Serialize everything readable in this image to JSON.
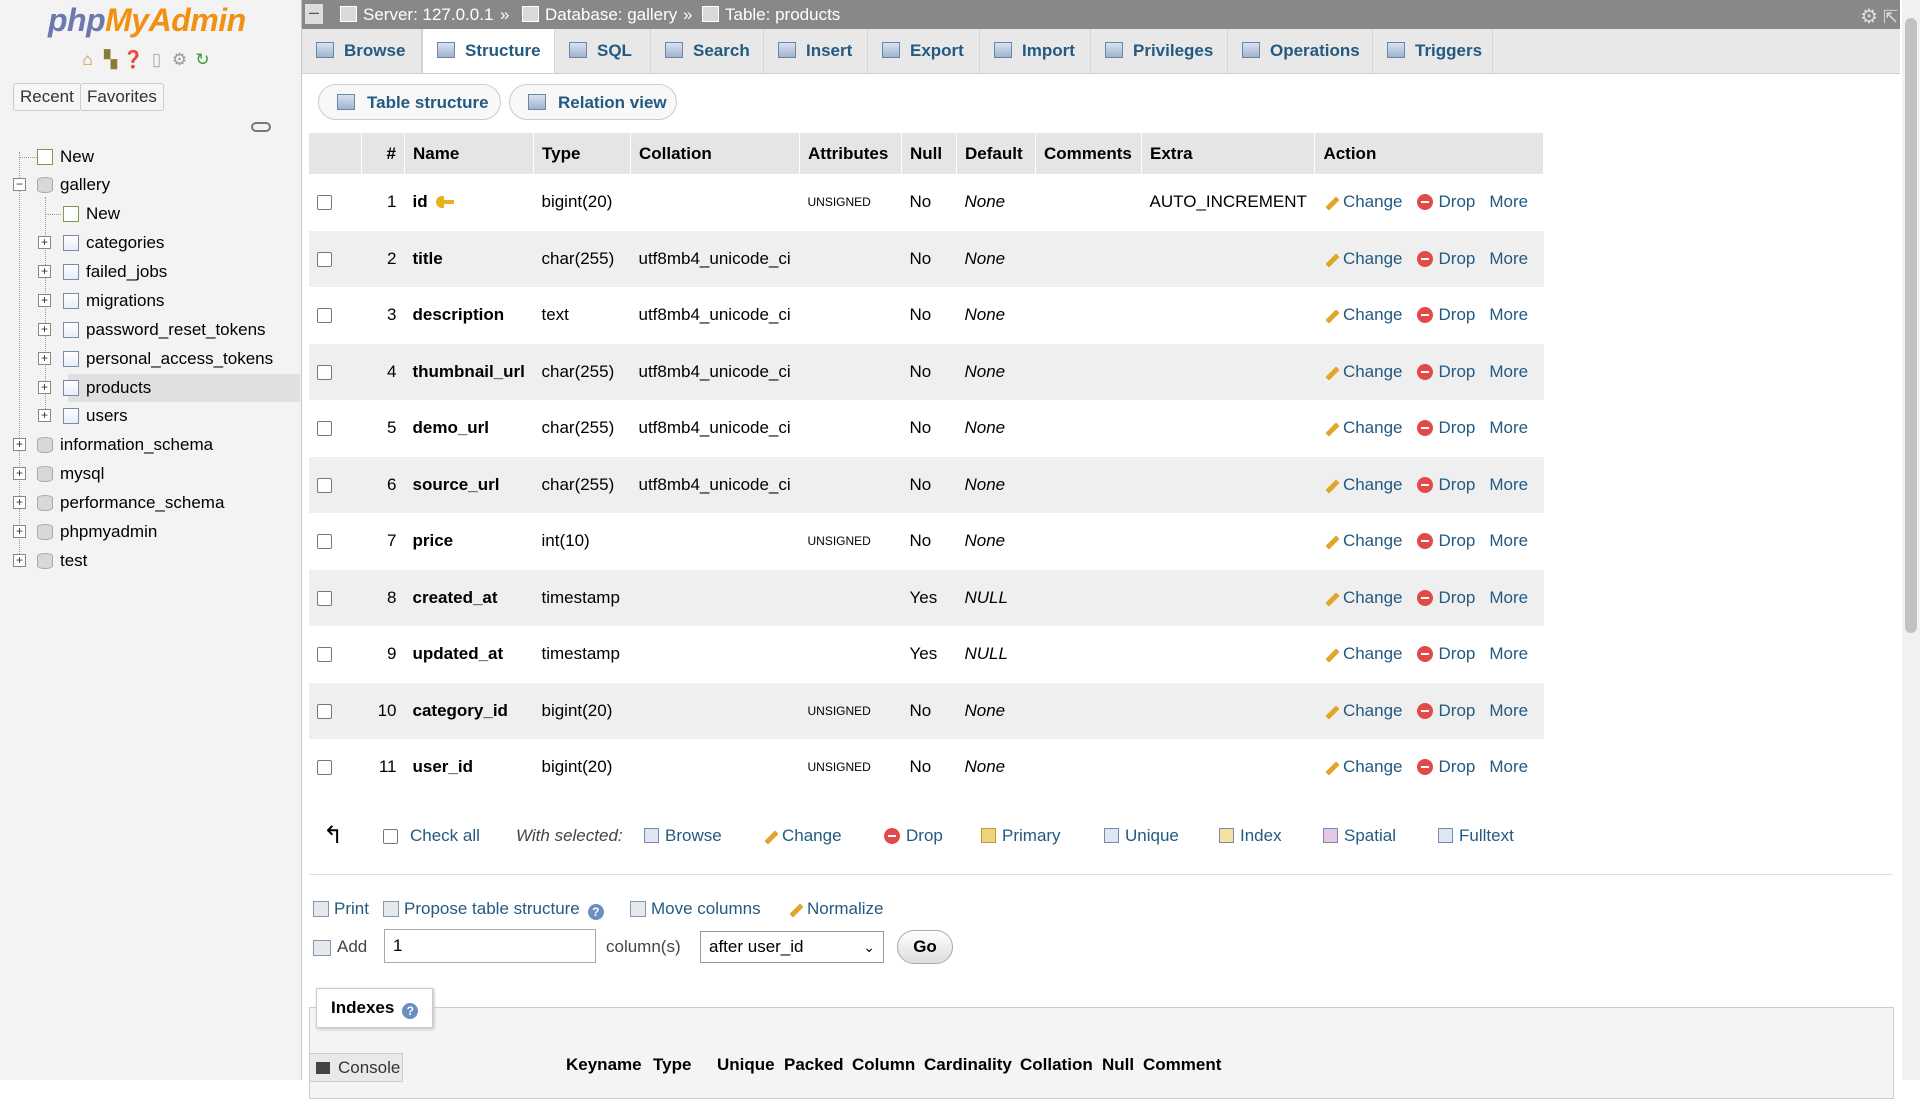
{
  "logo": {
    "php": "php",
    "myadmin": "MyAdmin"
  },
  "sidebar": {
    "quick_icons": [
      "home-icon",
      "exit-icon",
      "help-icon",
      "docs-icon",
      "settings-icon",
      "reload-icon"
    ],
    "recent_label": "Recent",
    "favorites_label": "Favorites",
    "tree": {
      "new_label": "New",
      "gallery": {
        "label": "gallery",
        "new_label": "New",
        "tables": [
          "categories",
          "failed_jobs",
          "migrations",
          "password_reset_tokens",
          "personal_access_tokens",
          "products",
          "users"
        ]
      },
      "databases": [
        "information_schema",
        "mysql",
        "performance_schema",
        "phpmyadmin",
        "test"
      ]
    }
  },
  "topbar": {
    "server": "Server: 127.0.0.1",
    "database": "Database: gallery",
    "table": "Table: products",
    "separator": "»"
  },
  "tabs": [
    "Browse",
    "Structure",
    "SQL",
    "Search",
    "Insert",
    "Export",
    "Import",
    "Privileges",
    "Operations",
    "Triggers"
  ],
  "active_tab": "Structure",
  "subtabs": [
    "Table structure",
    "Relation view"
  ],
  "columns_header": [
    "#",
    "Name",
    "Type",
    "Collation",
    "Attributes",
    "Null",
    "Default",
    "Comments",
    "Extra",
    "Action"
  ],
  "rows": [
    {
      "num": "1",
      "name": "id",
      "primary": true,
      "type": "bigint(20)",
      "collation": "",
      "attributes": "UNSIGNED",
      "null": "No",
      "default": "None",
      "comments": "",
      "extra": "AUTO_INCREMENT"
    },
    {
      "num": "2",
      "name": "title",
      "type": "char(255)",
      "collation": "utf8mb4_unicode_ci",
      "attributes": "",
      "null": "No",
      "default": "None",
      "comments": "",
      "extra": ""
    },
    {
      "num": "3",
      "name": "description",
      "type": "text",
      "collation": "utf8mb4_unicode_ci",
      "attributes": "",
      "null": "No",
      "default": "None",
      "comments": "",
      "extra": ""
    },
    {
      "num": "4",
      "name": "thumbnail_url",
      "type": "char(255)",
      "collation": "utf8mb4_unicode_ci",
      "attributes": "",
      "null": "No",
      "default": "None",
      "comments": "",
      "extra": ""
    },
    {
      "num": "5",
      "name": "demo_url",
      "type": "char(255)",
      "collation": "utf8mb4_unicode_ci",
      "attributes": "",
      "null": "No",
      "default": "None",
      "comments": "",
      "extra": ""
    },
    {
      "num": "6",
      "name": "source_url",
      "type": "char(255)",
      "collation": "utf8mb4_unicode_ci",
      "attributes": "",
      "null": "No",
      "default": "None",
      "comments": "",
      "extra": ""
    },
    {
      "num": "7",
      "name": "price",
      "type": "int(10)",
      "collation": "",
      "attributes": "UNSIGNED",
      "null": "No",
      "default": "None",
      "comments": "",
      "extra": ""
    },
    {
      "num": "8",
      "name": "created_at",
      "type": "timestamp",
      "collation": "",
      "attributes": "",
      "null": "Yes",
      "default": "NULL",
      "comments": "",
      "extra": ""
    },
    {
      "num": "9",
      "name": "updated_at",
      "type": "timestamp",
      "collation": "",
      "attributes": "",
      "null": "Yes",
      "default": "NULL",
      "comments": "",
      "extra": ""
    },
    {
      "num": "10",
      "name": "category_id",
      "type": "bigint(20)",
      "collation": "",
      "attributes": "UNSIGNED",
      "null": "No",
      "default": "None",
      "comments": "",
      "extra": ""
    },
    {
      "num": "11",
      "name": "user_id",
      "type": "bigint(20)",
      "collation": "",
      "attributes": "UNSIGNED",
      "null": "No",
      "default": "None",
      "comments": "",
      "extra": ""
    }
  ],
  "row_actions": {
    "change": "Change",
    "drop": "Drop",
    "more": "More"
  },
  "bulk": {
    "check_all": "Check all",
    "with_selected": "With selected:",
    "actions": [
      "Browse",
      "Change",
      "Drop",
      "Primary",
      "Unique",
      "Index",
      "Spatial",
      "Fulltext"
    ]
  },
  "tools": {
    "print": "Print",
    "propose": "Propose table structure",
    "move_columns": "Move columns",
    "normalize": "Normalize"
  },
  "add_columns": {
    "label": "Add",
    "value": "1",
    "unit": "column(s)",
    "position": "after user_id",
    "go": "Go"
  },
  "indexes": {
    "title": "Indexes",
    "columns": [
      "Keyname",
      "Type",
      "Unique",
      "Packed",
      "Column",
      "Cardinality",
      "Collation",
      "Null",
      "Comment"
    ]
  },
  "console_label": "Console",
  "colors": {
    "link": "#235a81",
    "topbar": "#888888",
    "tab_bg": "#e8e8e8",
    "logo_php": "#6c78af",
    "logo_myadmin": "#f29111"
  }
}
